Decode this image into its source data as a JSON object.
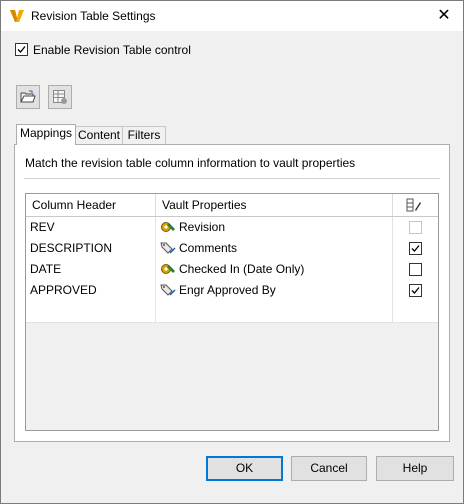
{
  "window": {
    "title": "Revision Table Settings",
    "close_glyph": "✕"
  },
  "enable": {
    "label": "Enable Revision Table control",
    "checked": true
  },
  "toolbar": {
    "buttons": [
      {
        "icon": "open-folder-icon"
      },
      {
        "icon": "table-settings-icon"
      }
    ]
  },
  "tabs": [
    {
      "label": "Mappings",
      "active": true
    },
    {
      "label": "Content",
      "active": false
    },
    {
      "label": "Filters",
      "active": false
    }
  ],
  "mappings": {
    "description": "Match the revision table column information to vault properties",
    "columns": {
      "column_header": "Column Header",
      "vault_properties": "Vault Properties",
      "edit_icon": "column-edit-icon"
    },
    "rows": [
      {
        "column": "REV",
        "property": "Revision",
        "icon": "system-property-icon",
        "checked": false,
        "disabled": true
      },
      {
        "column": "DESCRIPTION",
        "property": "Comments",
        "icon": "user-property-icon",
        "checked": true,
        "disabled": false
      },
      {
        "column": "DATE",
        "property": "Checked In (Date Only)",
        "icon": "system-property-icon",
        "checked": false,
        "disabled": false
      },
      {
        "column": "APPROVED",
        "property": "Engr Approved By",
        "icon": "user-property-icon",
        "checked": true,
        "disabled": false
      }
    ]
  },
  "buttons": {
    "ok": "OK",
    "cancel": "Cancel",
    "help": "Help"
  },
  "colors": {
    "accent": "#0078d7",
    "logo": "#f2a900"
  }
}
